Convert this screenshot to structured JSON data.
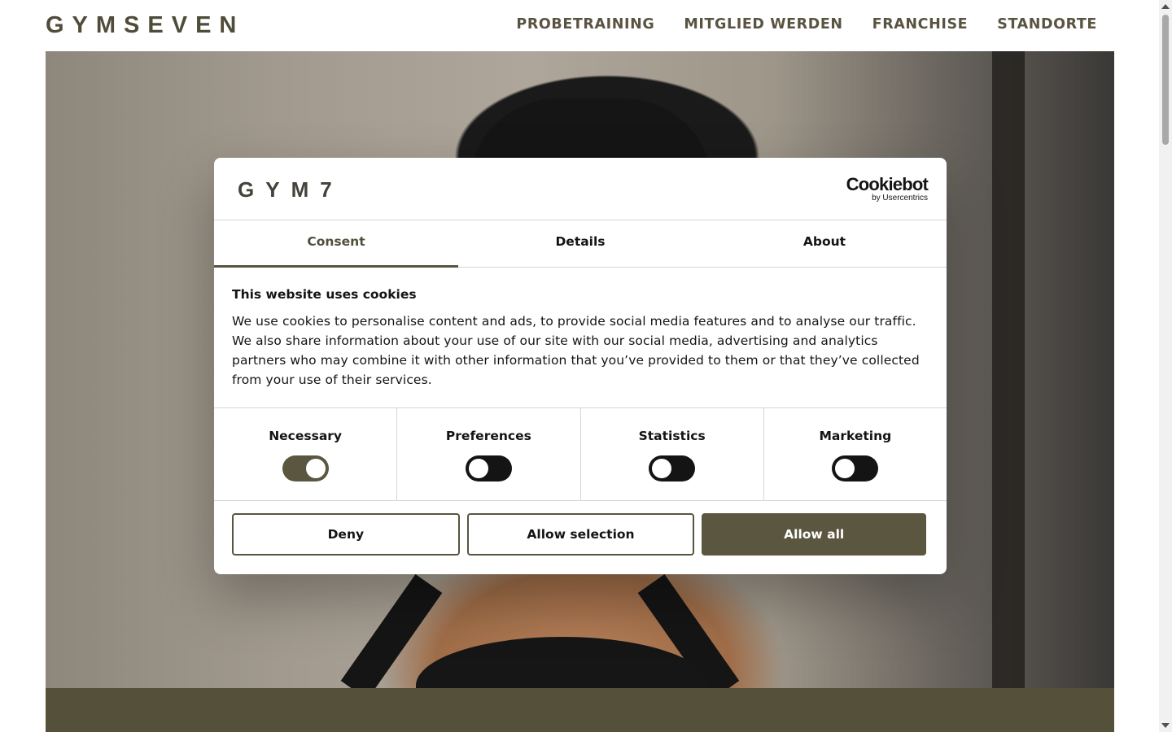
{
  "header": {
    "logo_text": "GYMSEVEN",
    "nav": [
      "PROBETRAINING",
      "MITGLIED WERDEN",
      "FRANCHISE",
      "STANDORTE"
    ]
  },
  "dialog": {
    "logo_text": "GYM7",
    "provider": {
      "name": "Cookiebot",
      "byline": "by Usercentrics"
    },
    "tabs": [
      {
        "label": "Consent",
        "active": true
      },
      {
        "label": "Details",
        "active": false
      },
      {
        "label": "About",
        "active": false
      }
    ],
    "title": "This website uses cookies",
    "text": "We use cookies to personalise content and ads, to provide social media features and to analyse our traffic. We also share information about your use of our site with our social media, advertising and analytics partners who may combine it with other information that you’ve provided to them or that they’ve collected from your use of their services.",
    "categories": [
      {
        "label": "Necessary",
        "enabled": true
      },
      {
        "label": "Preferences",
        "enabled": false
      },
      {
        "label": "Statistics",
        "enabled": false
      },
      {
        "label": "Marketing",
        "enabled": false
      }
    ],
    "buttons": {
      "deny": "Deny",
      "allow_selection": "Allow selection",
      "allow_all": "Allow all"
    }
  },
  "colors": {
    "brand_olive": "#58543f",
    "text_dark": "#141414"
  }
}
